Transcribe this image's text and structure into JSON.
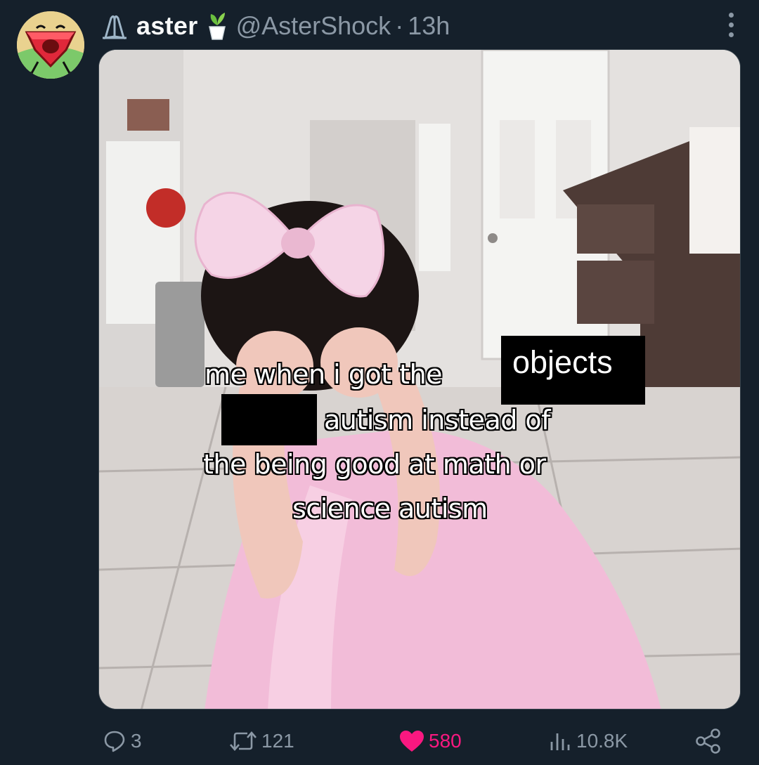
{
  "author": {
    "display_name": "aster",
    "handle": "@AsterShock",
    "separator": "·",
    "timestamp": "13h",
    "badge_icon": "praying-hands-icon",
    "emoji_icon": "herb-pot-icon"
  },
  "post": {
    "media": {
      "caption_lines": [
        "me when i got the",
        "autism instead of",
        "the being good at math or",
        "science autism"
      ],
      "inserted_word": "objects"
    }
  },
  "actions": {
    "replies": "3",
    "reposts": "121",
    "likes": "580",
    "views": "10.8K",
    "liked": true
  },
  "colors": {
    "background": "#15202b",
    "muted": "#8b98a5",
    "like": "#f91880",
    "text": "#f7f9f9"
  }
}
